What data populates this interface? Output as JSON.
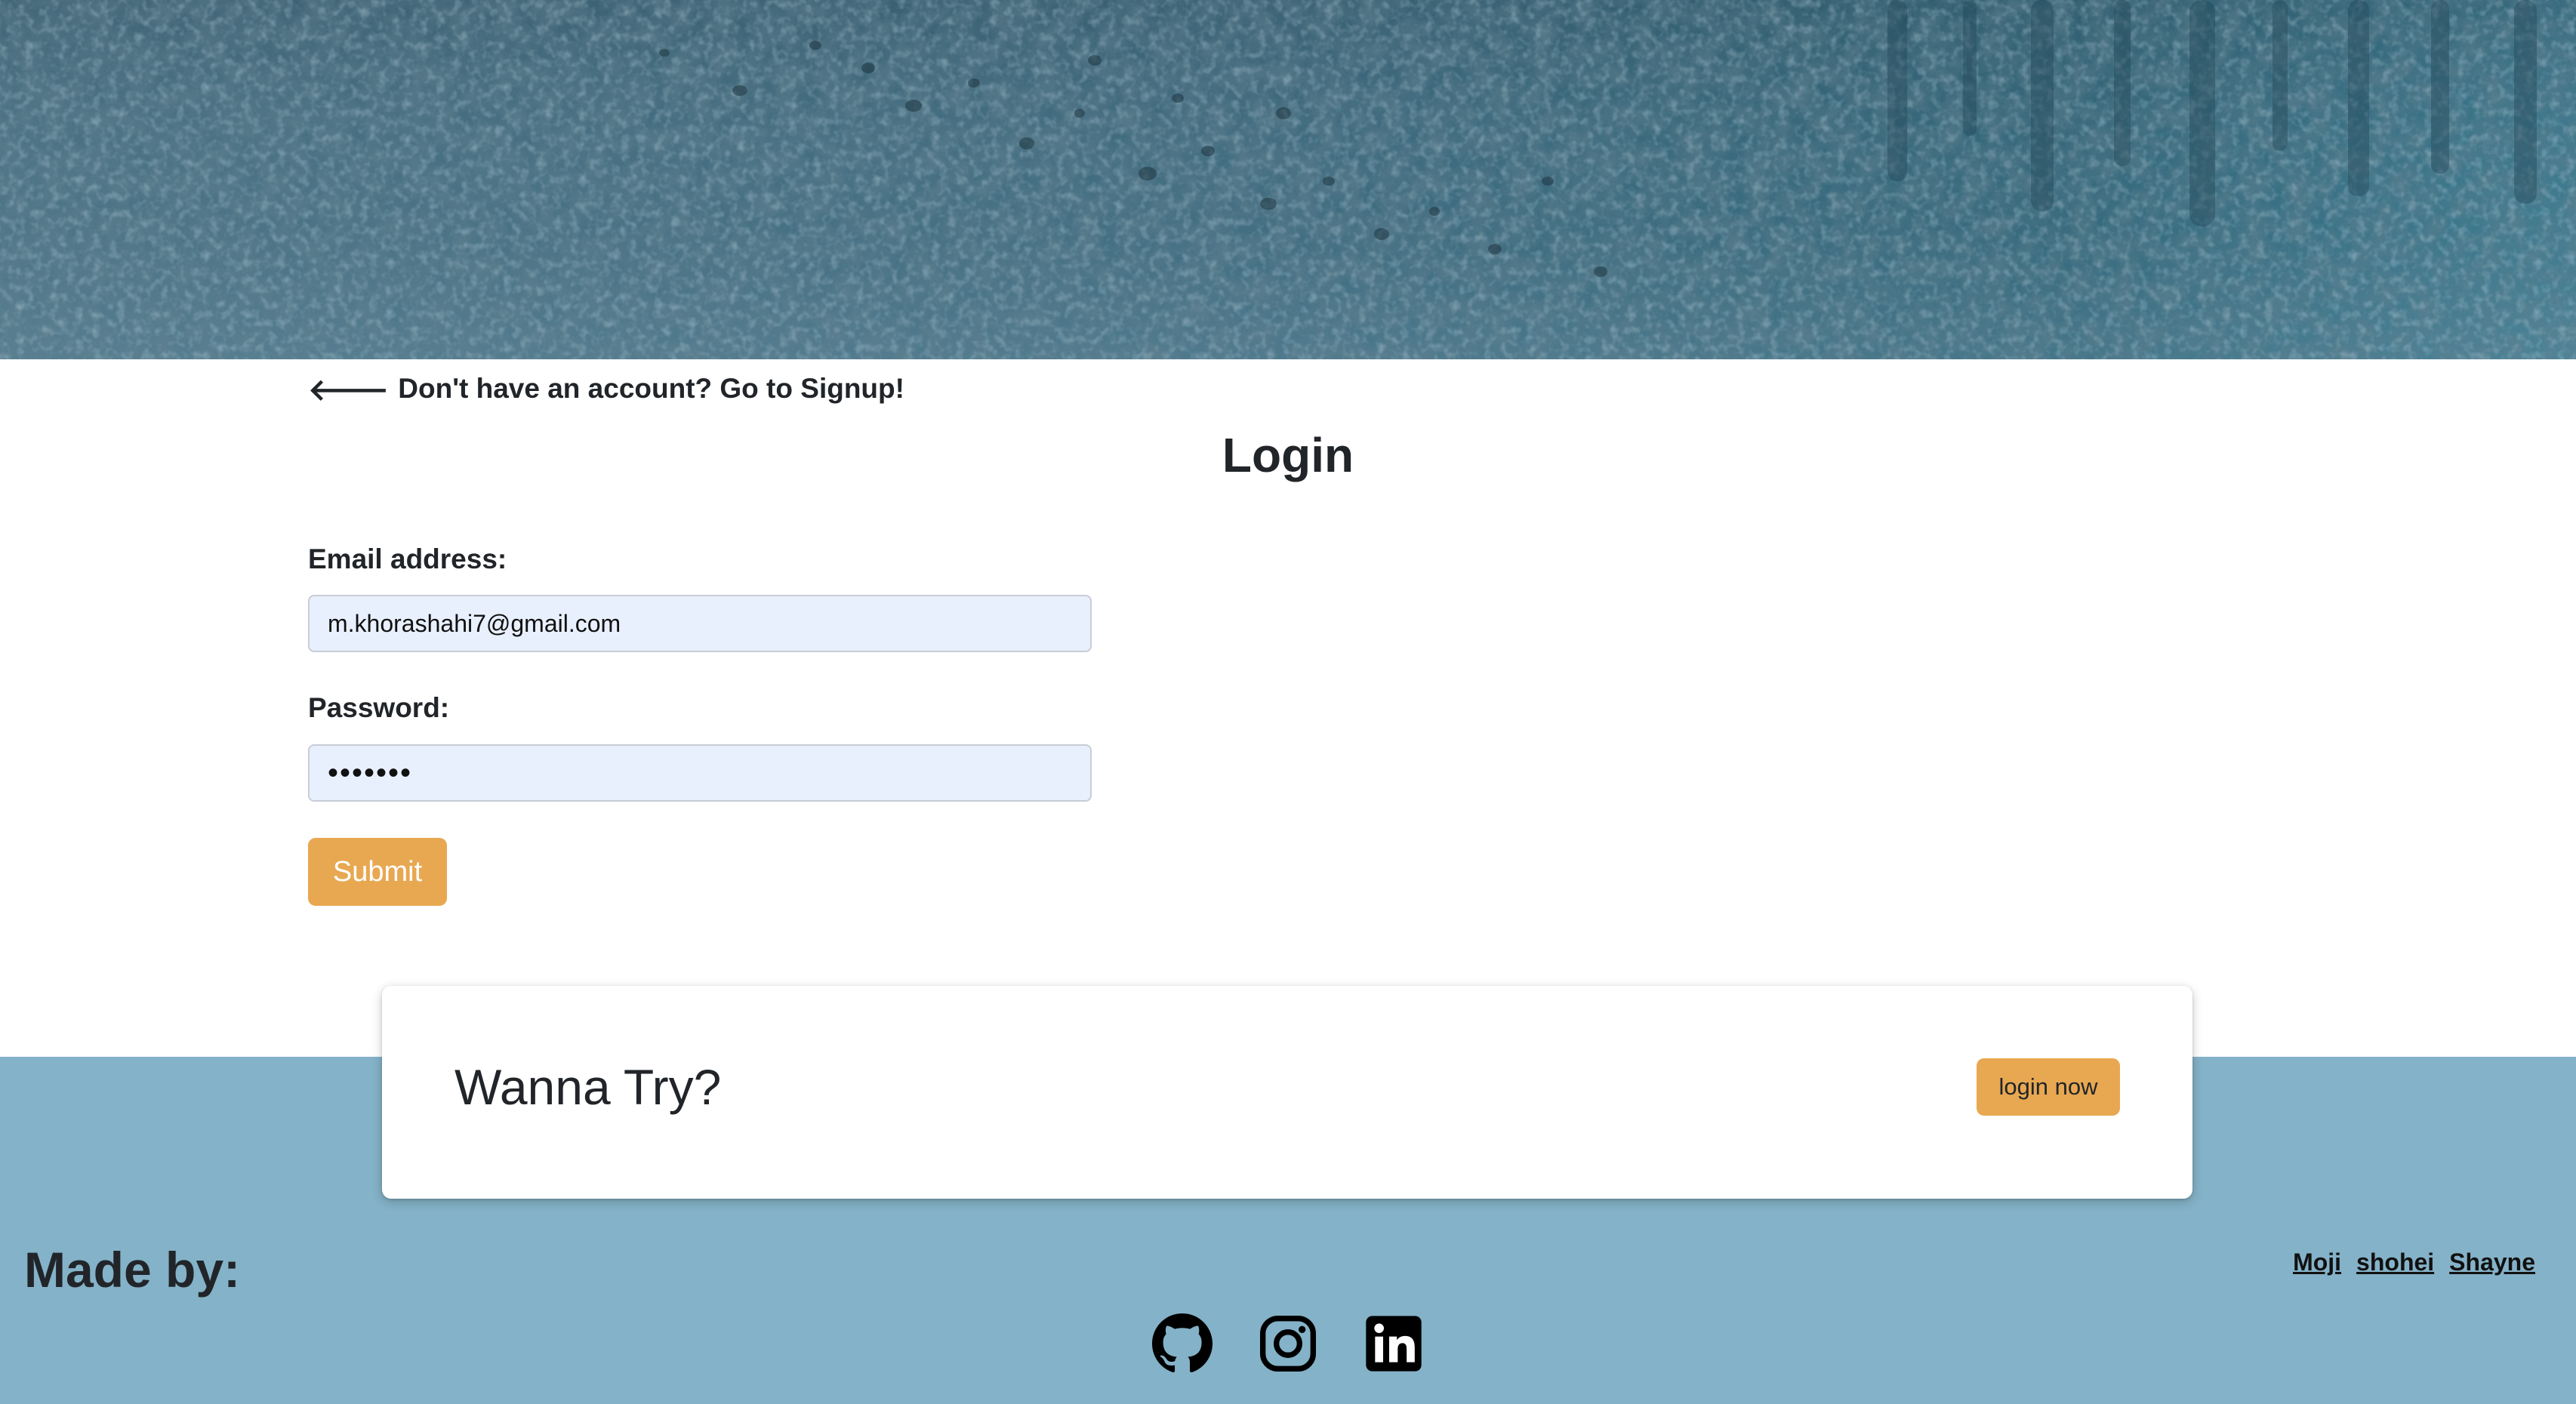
{
  "nav": {
    "back_arrow": "🡐",
    "signup_link": "Don't have an account? Go to Signup!"
  },
  "login": {
    "title": "Login",
    "email_label": "Email address:",
    "email_value": "m.khorashahi7@gmail.com",
    "password_label": "Password:",
    "password_mask": "•••••••",
    "submit_label": "Submit"
  },
  "cta": {
    "title": "Wanna Try?",
    "button_label": "login now"
  },
  "footer": {
    "made_by": "Made by:",
    "authors": [
      "Moji",
      "shohei",
      "Shayne"
    ],
    "social": [
      "github-icon",
      "instagram-icon",
      "linkedin-icon"
    ]
  },
  "colors": {
    "accent": "#e8a851",
    "footer_bg": "#84b2c8",
    "input_bg": "#e8f0fe",
    "hero": "#42697d"
  }
}
